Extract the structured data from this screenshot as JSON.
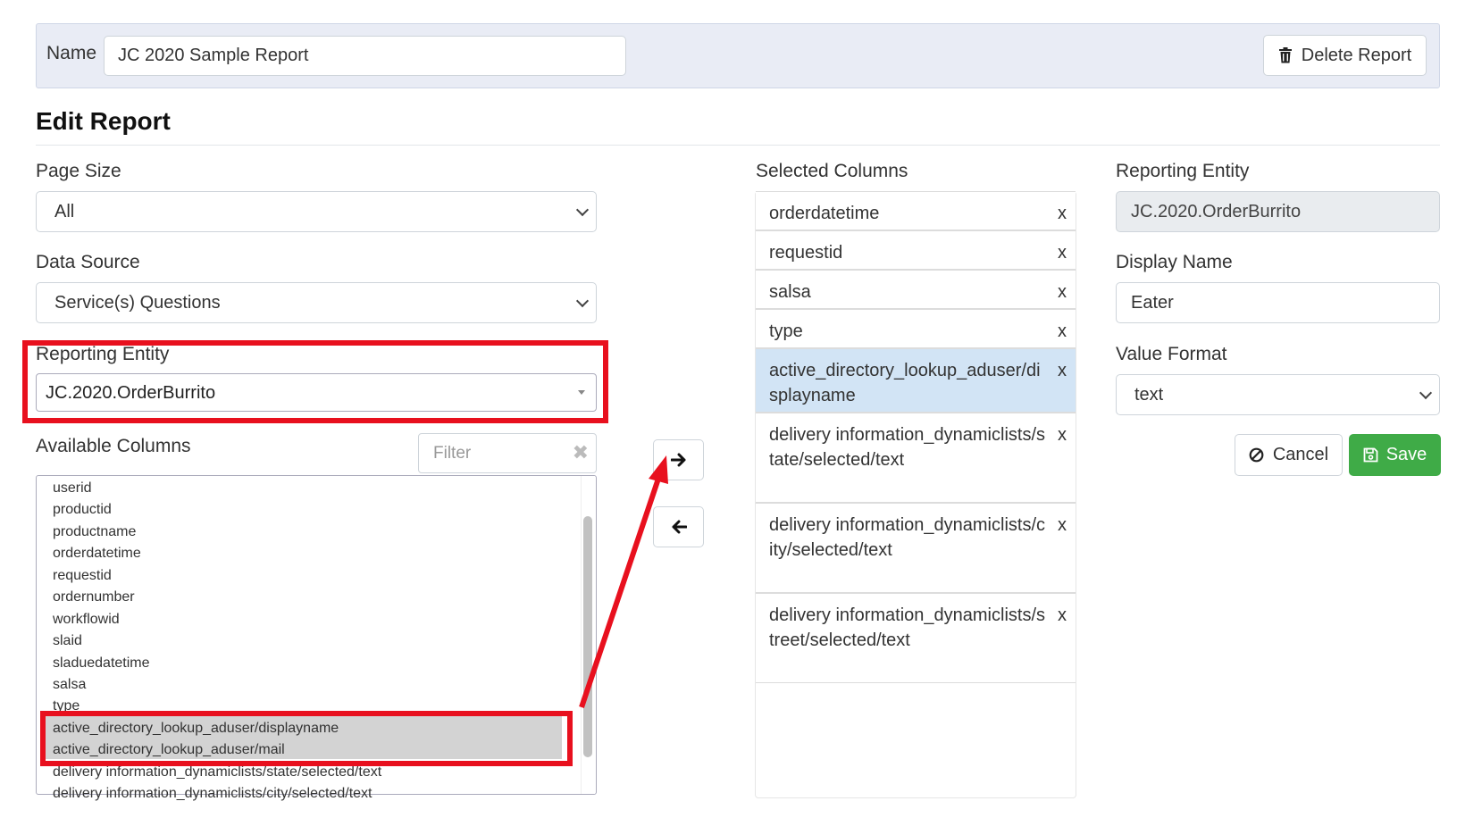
{
  "header": {
    "name_label": "Name",
    "name_value": "JC 2020 Sample Report",
    "delete_label": "Delete Report"
  },
  "page_title": "Edit Report",
  "left": {
    "page_size_label": "Page Size",
    "page_size_value": "All",
    "data_source_label": "Data Source",
    "data_source_value": "Service(s) Questions",
    "reporting_entity_label": "Reporting Entity",
    "reporting_entity_value": "JC.2020.OrderBurrito",
    "available_label": "Available Columns",
    "filter_placeholder": "Filter",
    "available_columns": [
      "userid",
      "productid",
      "productname",
      "orderdatetime",
      "requestid",
      "ordernumber",
      "workflowid",
      "slaid",
      "sladuedatetime",
      "salsa",
      "type",
      "active_directory_lookup_aduser/displayname",
      "active_directory_lookup_aduser/mail",
      "delivery information_dynamiclists/state/selected/text",
      "delivery information_dynamiclists/city/selected/text"
    ]
  },
  "middle": {
    "selected_label": "Selected Columns",
    "remove_glyph": "x",
    "selected_columns": [
      "orderdatetime",
      "requestid",
      "salsa",
      "type",
      "active_directory_lookup_aduser/displayname",
      "delivery information_dynamiclists/state/selected/text",
      "delivery information_dynamiclists/city/selected/text",
      "delivery information_dynamiclists/street/selected/text"
    ]
  },
  "right": {
    "reporting_entity_label": "Reporting Entity",
    "reporting_entity_value": "JC.2020.OrderBurrito",
    "display_name_label": "Display Name",
    "display_name_value": "Eater",
    "value_format_label": "Value Format",
    "value_format_value": "text",
    "cancel_label": "Cancel",
    "save_label": "Save"
  },
  "colors": {
    "annotation_red": "#e8101e",
    "save_green": "#3fab47",
    "active_row_blue": "#d2e4f5"
  }
}
